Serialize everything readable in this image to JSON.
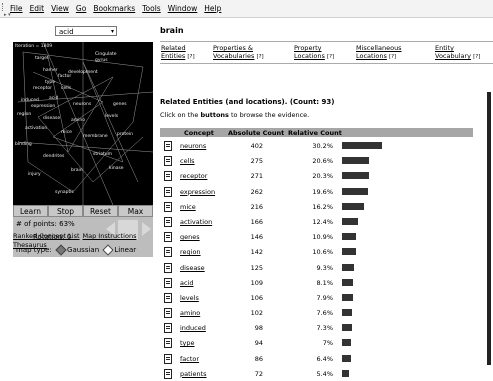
{
  "menubar": {
    "items": [
      "File",
      "Edit",
      "View",
      "Go",
      "Bookmarks",
      "Tools",
      "Window",
      "Help"
    ]
  },
  "left": {
    "select_value": "acid",
    "graph_words": [
      {
        "t": "Iteration = 1809"
      },
      {
        "t": "target"
      },
      {
        "t": "Cingulate"
      },
      {
        "t": "gyrus"
      },
      {
        "t": "development"
      },
      {
        "t": "hamer"
      },
      {
        "t": "factor"
      },
      {
        "t": "type"
      },
      {
        "t": "receptor"
      },
      {
        "t": "cells"
      },
      {
        "t": "induced"
      },
      {
        "t": "acid"
      },
      {
        "t": "expression"
      },
      {
        "t": "neurons"
      },
      {
        "t": "genes"
      },
      {
        "t": "region"
      },
      {
        "t": "disease"
      },
      {
        "t": "amino"
      },
      {
        "t": "levels"
      },
      {
        "t": "activation"
      },
      {
        "t": "mice"
      },
      {
        "t": "membrane"
      },
      {
        "t": "protein"
      },
      {
        "t": "binding"
      },
      {
        "t": "dendrites"
      },
      {
        "t": "striatum"
      },
      {
        "t": "injury"
      },
      {
        "t": "brain"
      },
      {
        "t": "kinase"
      },
      {
        "t": "synaptic"
      }
    ],
    "buttons": [
      "Learn",
      "Stop",
      "Reset",
      "Max"
    ],
    "points_label": "# of points: 63%",
    "rotation_label": "Rotation: 0",
    "map_type_label": "map type:",
    "radio_gaussian": "Gaussian",
    "radio_linear": "Linear",
    "links": [
      "Ranked Concept List",
      "Map Instructions",
      "Thesaurus"
    ]
  },
  "right": {
    "title": "brain",
    "tabs": [
      {
        "l1": "Related",
        "l2": "Entities",
        "q": "[?]"
      },
      {
        "l1": "Properties &",
        "l2": "Vocabularies",
        "q": "[?]"
      },
      {
        "l1": "Property",
        "l2": "Locations",
        "q": "[?]"
      },
      {
        "l1": "Miscellaneous",
        "l2": "Locations",
        "q": "[?]"
      },
      {
        "l1": "Entity",
        "l2": "Vocabulary",
        "q": "[?]"
      }
    ],
    "section_title": "Related Entities (and locations). (Count: 93)",
    "hint_pre": "Click on the ",
    "hint_bold": "buttons",
    "hint_post": " to browse the evidence.",
    "headers": [
      "Concept",
      "Absolute Count",
      "Relative Count"
    ],
    "rows": [
      {
        "concept": "neurons",
        "abs": "402",
        "rel": "30.2%",
        "frac": 0.302
      },
      {
        "concept": "cells",
        "abs": "275",
        "rel": "20.6%",
        "frac": 0.206
      },
      {
        "concept": "receptor",
        "abs": "271",
        "rel": "20.3%",
        "frac": 0.203
      },
      {
        "concept": "expression",
        "abs": "262",
        "rel": "19.6%",
        "frac": 0.196
      },
      {
        "concept": "mice",
        "abs": "216",
        "rel": "16.2%",
        "frac": 0.162
      },
      {
        "concept": "activation",
        "abs": "166",
        "rel": "12.4%",
        "frac": 0.124
      },
      {
        "concept": "genes",
        "abs": "146",
        "rel": "10.9%",
        "frac": 0.109
      },
      {
        "concept": "region",
        "abs": "142",
        "rel": "10.6%",
        "frac": 0.106
      },
      {
        "concept": "disease",
        "abs": "125",
        "rel": "9.3%",
        "frac": 0.093
      },
      {
        "concept": "acid",
        "abs": "109",
        "rel": "8.1%",
        "frac": 0.081
      },
      {
        "concept": "levels",
        "abs": "106",
        "rel": "7.9%",
        "frac": 0.079
      },
      {
        "concept": "amino",
        "abs": "102",
        "rel": "7.6%",
        "frac": 0.076
      },
      {
        "concept": "induced",
        "abs": "98",
        "rel": "7.3%",
        "frac": 0.073
      },
      {
        "concept": "type",
        "abs": "94",
        "rel": "7%",
        "frac": 0.07
      },
      {
        "concept": "factor",
        "abs": "86",
        "rel": "6.4%",
        "frac": 0.064
      },
      {
        "concept": "patients",
        "abs": "72",
        "rel": "5.4%",
        "frac": 0.054
      }
    ]
  }
}
